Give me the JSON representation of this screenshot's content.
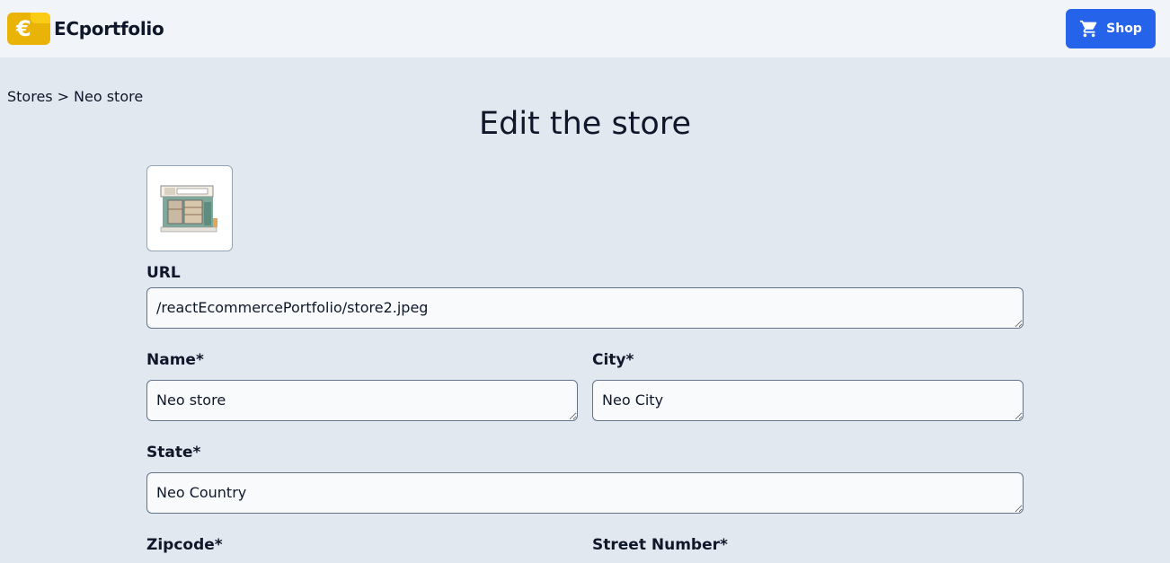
{
  "app": {
    "brand_name": "ECportfolio",
    "logo_symbol": "€",
    "shop_label": "Shop"
  },
  "breadcrumb": {
    "root": "Stores",
    "separator": ">",
    "current": "Neo store"
  },
  "page": {
    "title": "Edit the store"
  },
  "form": {
    "url_label": "URL",
    "url_value": "/reactEcommercePortfolio/store2.jpeg",
    "name_label": "Name*",
    "name_value": "Neo store",
    "city_label": "City*",
    "city_value": "Neo City",
    "state_label": "State*",
    "state_value": "Neo Country",
    "zipcode_label": "Zipcode*",
    "street_number_label": "Street Number*"
  },
  "colors": {
    "accent": "#2563eb",
    "logo": "#eab308",
    "background": "#e2e8f0",
    "navbar": "#f1f5f9"
  }
}
